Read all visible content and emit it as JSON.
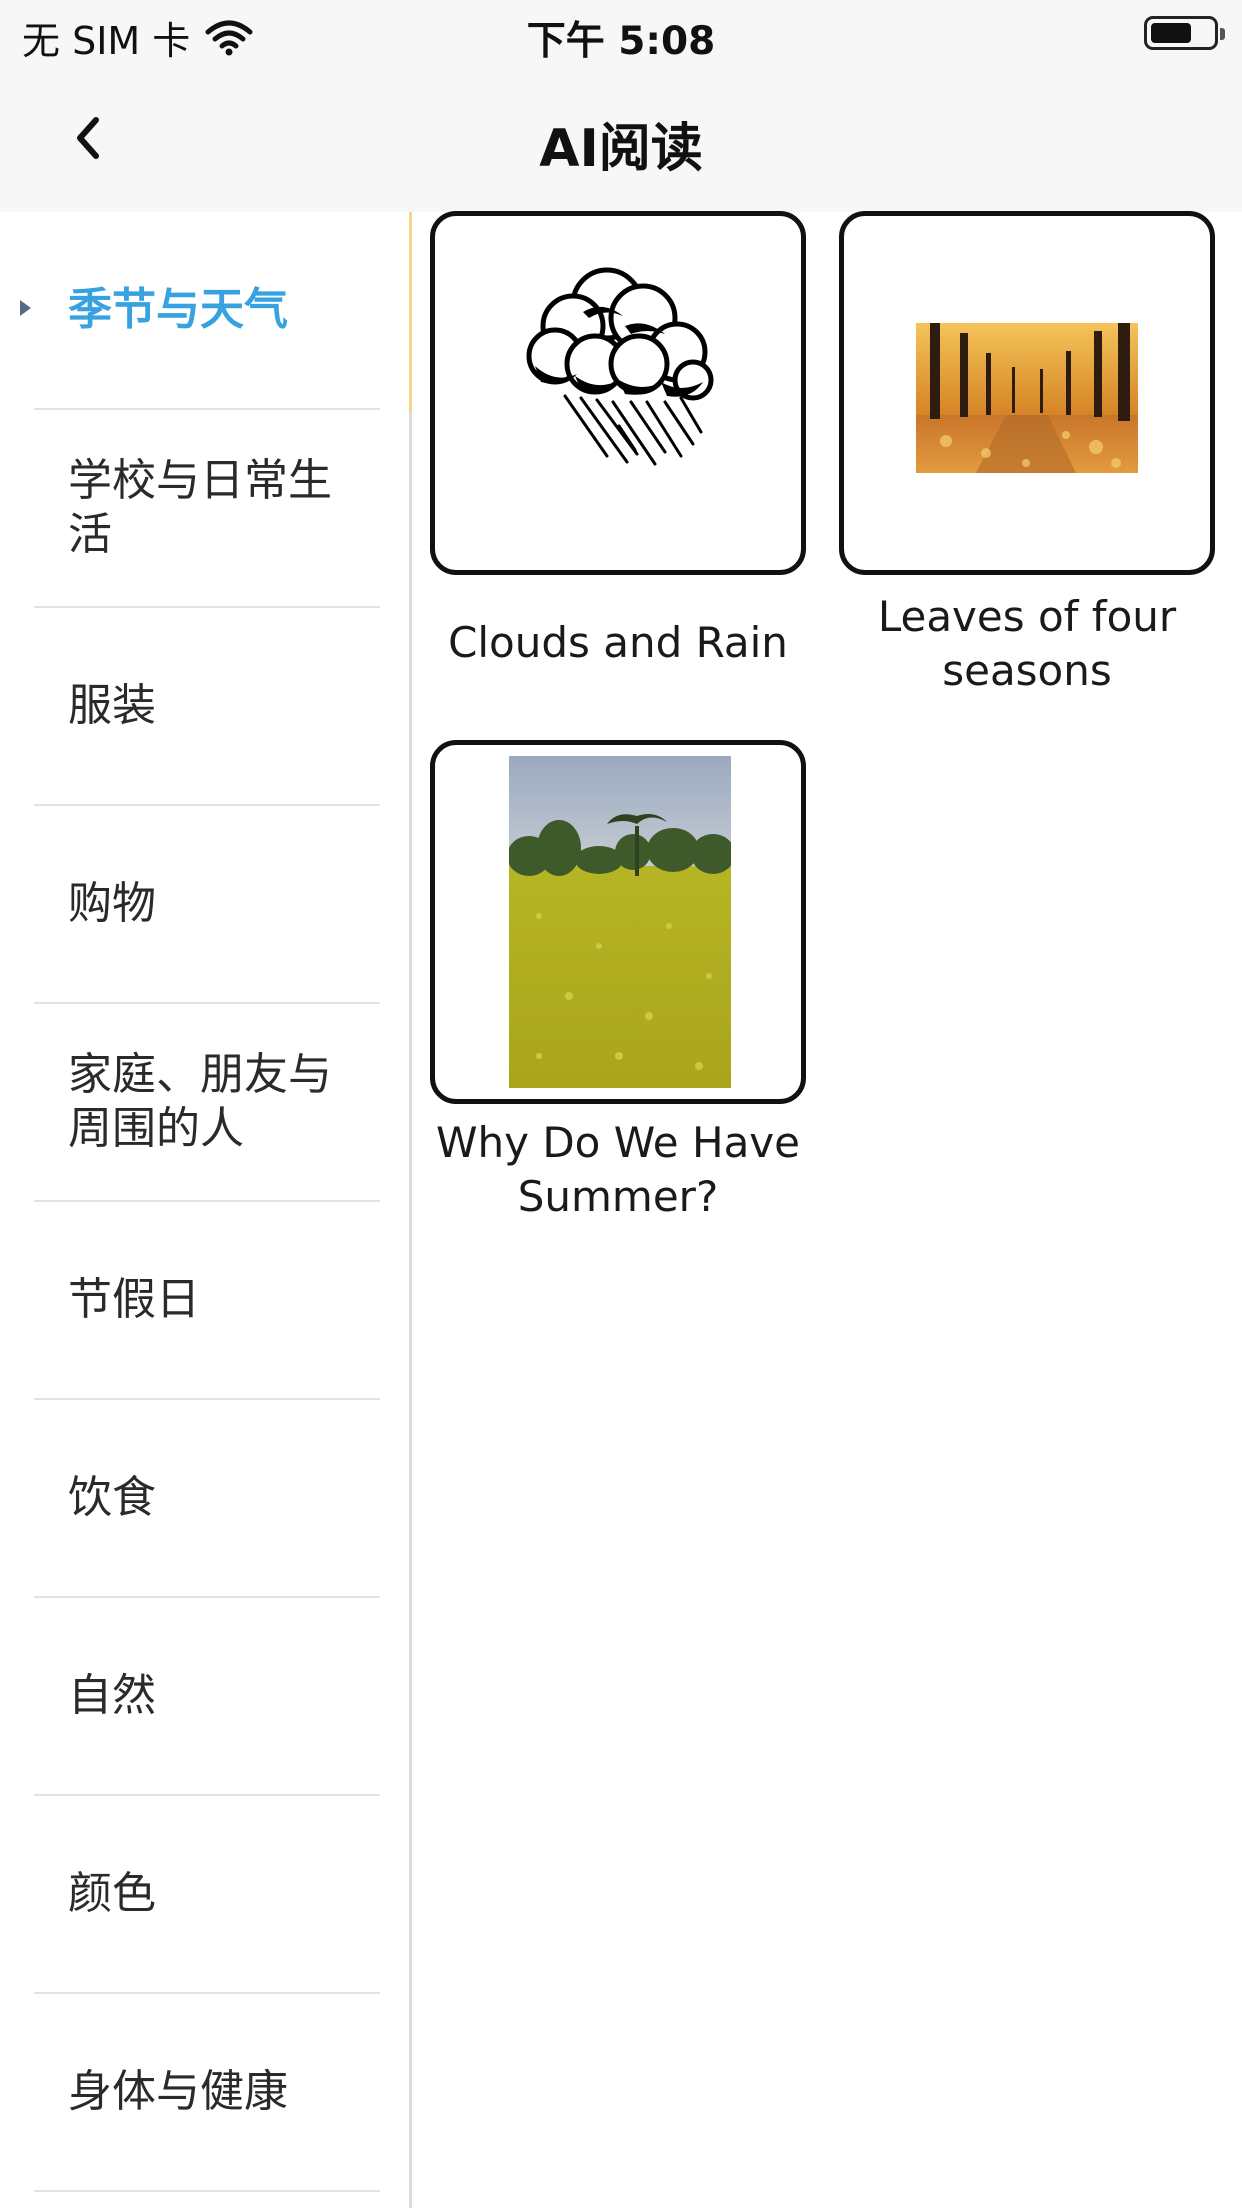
{
  "status_bar": {
    "carrier": "无 SIM 卡",
    "time": "下午 5:08",
    "icons": [
      "wifi-icon",
      "battery-icon"
    ]
  },
  "nav": {
    "title": "AI阅读",
    "back_icon": "chevron-left-icon"
  },
  "sidebar": {
    "active_index": 0,
    "active_color": "#38a2e0",
    "items": [
      {
        "label": "季节与天气"
      },
      {
        "label": "学校与日常生活"
      },
      {
        "label": "服装"
      },
      {
        "label": "购物"
      },
      {
        "label": "家庭、朋友与周围的人"
      },
      {
        "label": "节假日"
      },
      {
        "label": "饮食"
      },
      {
        "label": "自然"
      },
      {
        "label": "颜色"
      },
      {
        "label": "身体与健康"
      }
    ]
  },
  "books": [
    {
      "title": "Clouds and Rain",
      "thumb": "rain-cloud-icon"
    },
    {
      "title": "Leaves of four seasons",
      "thumb": "autumn-leaves-photo"
    },
    {
      "title": "Why Do We Have Summer?",
      "thumb": "summer-field-photo"
    }
  ]
}
